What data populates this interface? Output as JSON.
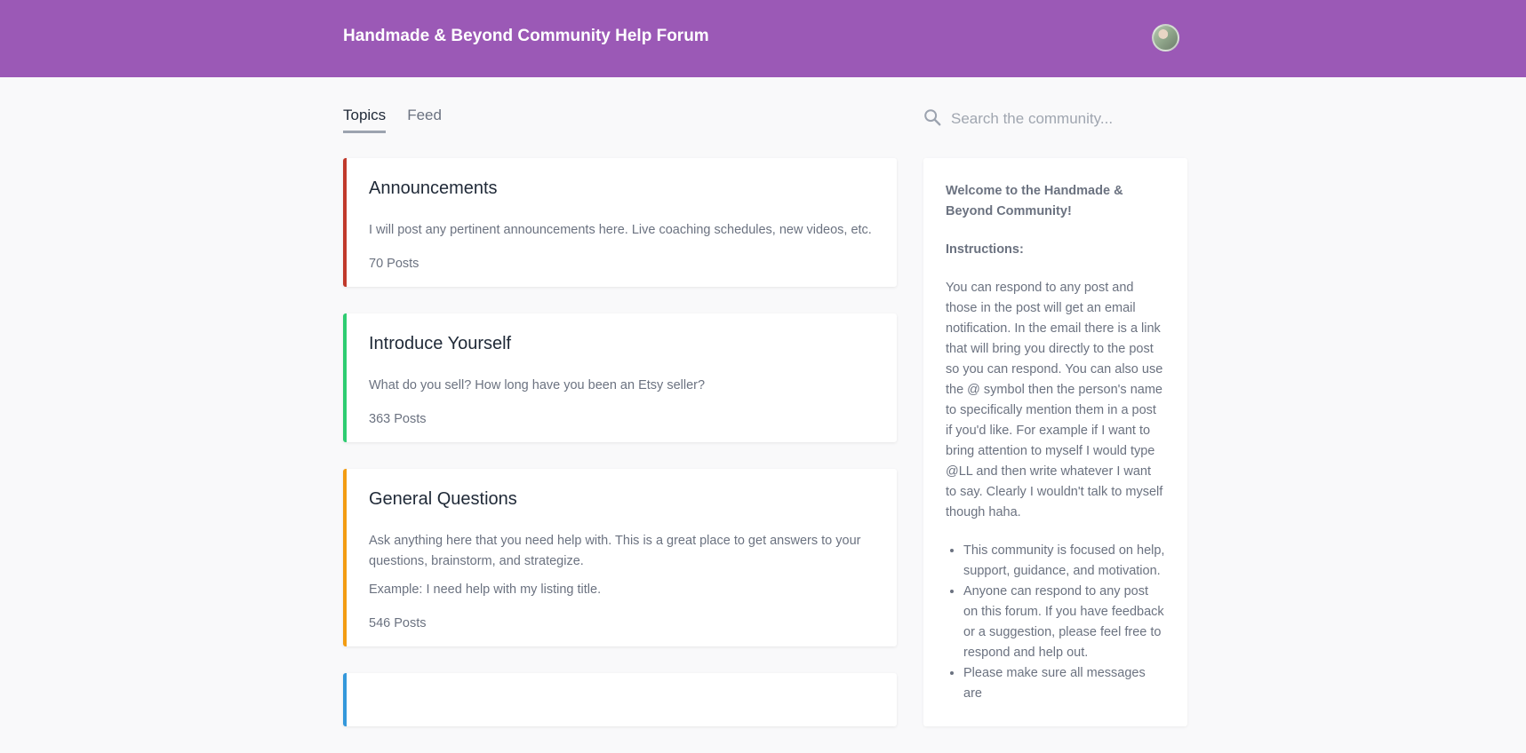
{
  "header": {
    "title": "Handmade & Beyond Community Help Forum",
    "background": "#9b59b6"
  },
  "nav": {
    "tabs": [
      {
        "label": "Topics",
        "active": true
      },
      {
        "label": "Feed",
        "active": false
      }
    ]
  },
  "search": {
    "placeholder": "Search the community...",
    "icon": "search-icon"
  },
  "topics": [
    {
      "title": "Announcements",
      "descriptions": [
        "I will post any pertinent announcements here. Live coaching schedules, new videos, etc."
      ],
      "count": "70 Posts",
      "color": "#c0392b"
    },
    {
      "title": "Introduce Yourself",
      "descriptions": [
        "What do you sell? How long have you been an Etsy seller?"
      ],
      "count": "363 Posts",
      "color": "#2ecc71"
    },
    {
      "title": "General Questions",
      "descriptions": [
        "Ask anything here that you need help with. This is a great place to get answers to your questions, brainstorm, and strategize.",
        "Example: I need help with my listing title."
      ],
      "count": "546 Posts",
      "color": "#f39c12"
    },
    {
      "title": "",
      "descriptions": [],
      "count": "",
      "color": "#3498db"
    }
  ],
  "sidebar": {
    "welcome": "Welcome to the Handmade & Beyond Community!",
    "instructions_heading": "Instructions:",
    "instructions_body": "You can respond to any post and those in the post will get an email notification.  In the email there is a link that will bring you directly to the post so you can respond.  You can also use the @ symbol then the person's name to specifically mention them in a post if you'd like.  For example if I want to bring attention to myself I would type @LL and then write whatever I want to say.  Clearly I wouldn't talk to myself though haha.",
    "bullets": [
      "This community is focused on help, support, guidance, and motivation.",
      "Anyone can respond to any post on this forum.  If you have feedback or a suggestion, please feel free to respond and help out.",
      "Please make sure all messages are"
    ]
  }
}
